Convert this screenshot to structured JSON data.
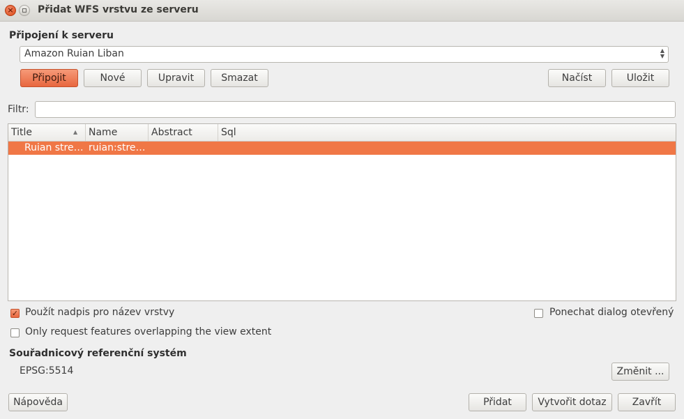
{
  "window": {
    "title": "Přidat WFS vrstvu ze serveru"
  },
  "connection": {
    "section_label": "Připojení k serveru",
    "selected_server": "Amazon Ruian Liban",
    "buttons": {
      "connect": "Připojit",
      "new": "Nové",
      "edit": "Upravit",
      "delete": "Smazat",
      "load": "Načíst",
      "save": "Uložit"
    }
  },
  "filter": {
    "label": "Filtr:",
    "value": ""
  },
  "table": {
    "columns": [
      "Title",
      "Name",
      "Abstract",
      "Sql"
    ],
    "rows": [
      {
        "title": "Ruian stre…",
        "name": "ruian:stre…",
        "abstract": "",
        "sql": ""
      }
    ]
  },
  "options": {
    "use_title": {
      "label": "Použít nadpis pro název vrstvy",
      "checked": true
    },
    "keep_open": {
      "label": "Ponechat dialog otevřený",
      "checked": false
    },
    "only_overlap": {
      "label": "Only request features overlapping the view extent",
      "checked": false
    }
  },
  "crs": {
    "section_label": "Souřadnicový referenční systém",
    "value": "EPSG:5514",
    "change_button": "Změnit ..."
  },
  "footer": {
    "help": "Nápověda",
    "add": "Přidat",
    "build_query": "Vytvořit dotaz",
    "close": "Zavřít"
  },
  "colors": {
    "accent": "#f07746",
    "background": "#efefef"
  },
  "icons": {
    "close": "close-icon",
    "minimize": "minimize-icon",
    "sort": "sort-ascending-icon",
    "combo": "updown-arrows-icon"
  }
}
